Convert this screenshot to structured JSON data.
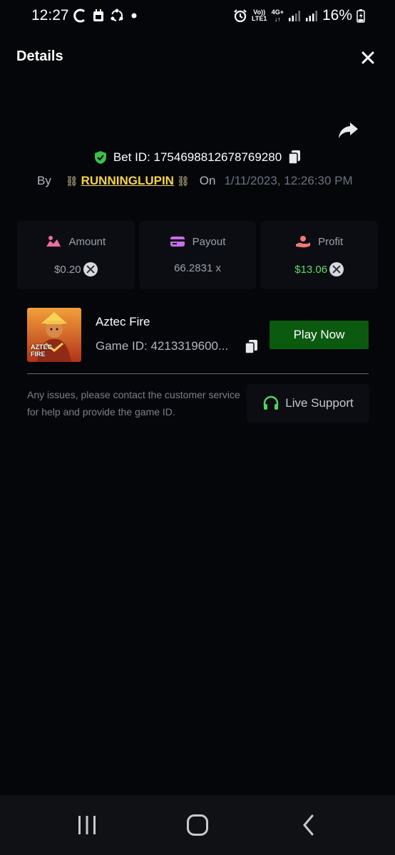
{
  "status_bar": {
    "time": "12:27",
    "network_label": "Vo)) LTE1",
    "network_type": "4G+",
    "battery": "16%",
    "icons": [
      "c-icon",
      "calendar-icon",
      "sync-icon",
      "dot-icon",
      "alarm-icon",
      "signal-icon",
      "signal-icon",
      "battery-charging-icon"
    ]
  },
  "header": {
    "title": "Details",
    "close_icon": "close-icon"
  },
  "share_icon": "share-icon",
  "bet": {
    "id_text": "Bet ID: 1754698812678769280",
    "by_label": "By",
    "username": "RUNNINGLUPIN",
    "chain_decoration": "⛓",
    "on_label": "On",
    "date": "1/11/2023, 12:26:30 PM"
  },
  "stats": {
    "amount": {
      "label": "Amount",
      "value": "$0.20"
    },
    "payout": {
      "label": "Payout",
      "value": "66.2831 x"
    },
    "profit": {
      "label": "Profit",
      "value": "$13.06"
    }
  },
  "game": {
    "name": "Aztec Fire",
    "id_text": "Game ID: 4213319600...",
    "thumb_line1": "AZTEC",
    "thumb_line2": "FIRE",
    "play_label": "Play Now"
  },
  "help": {
    "text": "Any issues, please contact the customer service for help and provide the game ID.",
    "support_label": "Live Support"
  },
  "colors": {
    "background": "#05060a",
    "accent_green": "#0b5a10",
    "profit_green": "#5fdc6a",
    "username_yellow": "#f7d44a",
    "shield_green": "#3cc04a"
  }
}
